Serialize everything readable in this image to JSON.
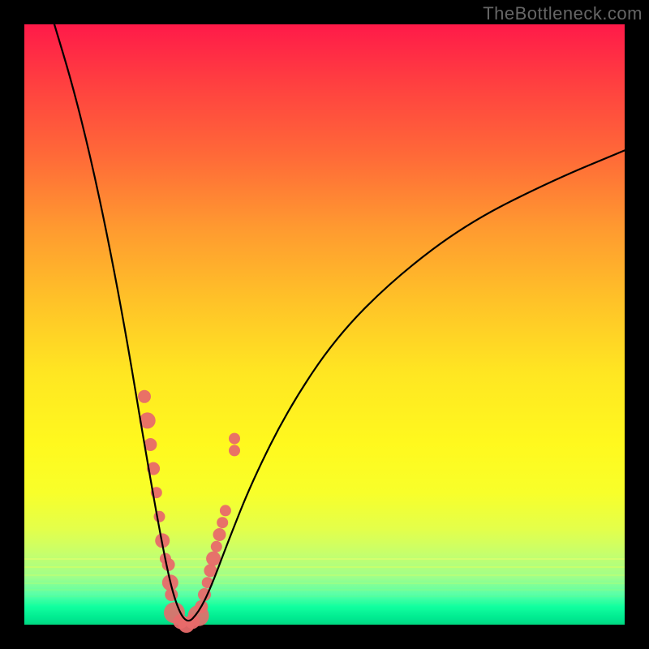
{
  "watermark": "TheBottleneck.com",
  "chart_data": {
    "type": "line",
    "title": "",
    "xlabel": "",
    "ylabel": "",
    "xlim": [
      0,
      100
    ],
    "ylim": [
      0,
      100
    ],
    "grid": false,
    "legend": false,
    "background_gradient": "red→orange→yellow→green (top to bottom)",
    "minimum_x": 27,
    "description": "V-shaped bottleneck curve with minimum near x≈27; left branch steep, right branch asymptotic toward ~80% at far right.",
    "curve_points": [
      {
        "x": 5,
        "y": 100
      },
      {
        "x": 8,
        "y": 90
      },
      {
        "x": 11,
        "y": 78
      },
      {
        "x": 14,
        "y": 64
      },
      {
        "x": 17,
        "y": 48
      },
      {
        "x": 20,
        "y": 30
      },
      {
        "x": 23,
        "y": 13
      },
      {
        "x": 25,
        "y": 4
      },
      {
        "x": 27,
        "y": 0
      },
      {
        "x": 29,
        "y": 2
      },
      {
        "x": 31,
        "y": 6
      },
      {
        "x": 34,
        "y": 14
      },
      {
        "x": 38,
        "y": 24
      },
      {
        "x": 44,
        "y": 36
      },
      {
        "x": 52,
        "y": 48
      },
      {
        "x": 62,
        "y": 58
      },
      {
        "x": 74,
        "y": 67
      },
      {
        "x": 88,
        "y": 74
      },
      {
        "x": 100,
        "y": 79
      }
    ],
    "markers": {
      "color": "#e86a6a",
      "radius_range": [
        5,
        14
      ],
      "note": "Clustered marker dots along the lower V region, larger-radius markers being semi-translucent pink circles near the trough and smaller ones along the branches.",
      "points": [
        {
          "x": 20,
          "y": 38,
          "r": 8
        },
        {
          "x": 20.5,
          "y": 34,
          "r": 10
        },
        {
          "x": 21,
          "y": 30,
          "r": 8
        },
        {
          "x": 21.5,
          "y": 26,
          "r": 8
        },
        {
          "x": 22,
          "y": 22,
          "r": 7
        },
        {
          "x": 22.5,
          "y": 18,
          "r": 7
        },
        {
          "x": 23,
          "y": 14,
          "r": 9
        },
        {
          "x": 23.5,
          "y": 11,
          "r": 7
        },
        {
          "x": 24,
          "y": 10,
          "r": 8
        },
        {
          "x": 24.3,
          "y": 7,
          "r": 10
        },
        {
          "x": 24.5,
          "y": 5,
          "r": 8
        },
        {
          "x": 25,
          "y": 2,
          "r": 13
        },
        {
          "x": 26,
          "y": 0.5,
          "r": 9
        },
        {
          "x": 27,
          "y": 0,
          "r": 10
        },
        {
          "x": 28,
          "y": 0.5,
          "r": 9
        },
        {
          "x": 29,
          "y": 1.5,
          "r": 13
        },
        {
          "x": 29.5,
          "y": 3,
          "r": 8
        },
        {
          "x": 30,
          "y": 5,
          "r": 8
        },
        {
          "x": 30.5,
          "y": 7,
          "r": 7
        },
        {
          "x": 31,
          "y": 9,
          "r": 8
        },
        {
          "x": 31.5,
          "y": 11,
          "r": 9
        },
        {
          "x": 32,
          "y": 13,
          "r": 7
        },
        {
          "x": 32.5,
          "y": 15,
          "r": 8
        },
        {
          "x": 33,
          "y": 17,
          "r": 7
        },
        {
          "x": 33.5,
          "y": 19,
          "r": 7
        },
        {
          "x": 35,
          "y": 29,
          "r": 7
        },
        {
          "x": 35,
          "y": 31,
          "r": 7
        }
      ]
    }
  }
}
